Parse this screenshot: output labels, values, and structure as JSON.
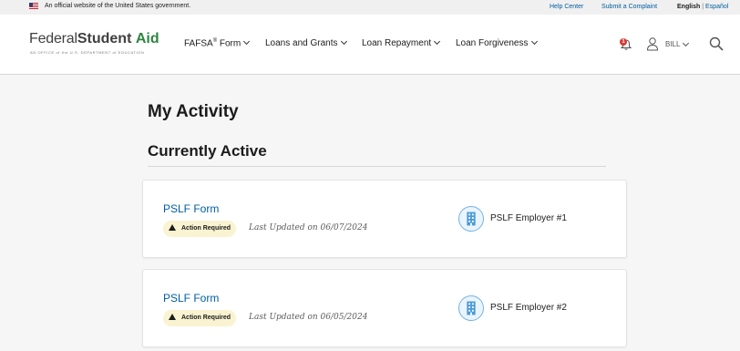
{
  "gov_banner": {
    "text": "An official website of the United States government.",
    "help_center": "Help Center",
    "submit_complaint": "Submit a Complaint",
    "lang_english": "English",
    "lang_separator": "|",
    "lang_spanish": "Español"
  },
  "header": {
    "logo": {
      "part1": "Federal",
      "part2": "Student",
      "part3": "Aid",
      "tagline": "AN OFFICE of the U.S. DEPARTMENT of EDUCATION"
    },
    "nav": {
      "fafsa": "FAFSA",
      "fafsa_mark": "®",
      "fafsa_suffix": " Form",
      "loans": "Loans and Grants",
      "repayment": "Loan Repayment",
      "forgiveness": "Loan Forgiveness"
    },
    "notification_count": "1",
    "user_name": "BILL"
  },
  "main": {
    "page_title": "My Activity",
    "section_title": "Currently Active",
    "cards": [
      {
        "form_name": "PSLF Form",
        "status": "Action Required",
        "updated": "Last Updated on 06/07/2024",
        "employer": "PSLF Employer #1"
      },
      {
        "form_name": "PSLF Form",
        "status": "Action Required",
        "updated": "Last Updated on 06/05/2024",
        "employer": "PSLF Employer #2"
      }
    ]
  },
  "colors": {
    "link": "#005ea2",
    "logo_green": "#2e8540",
    "badge_bg": "#faf3d1",
    "notification": "#d83933",
    "employer_icon": "#73b3e7"
  }
}
